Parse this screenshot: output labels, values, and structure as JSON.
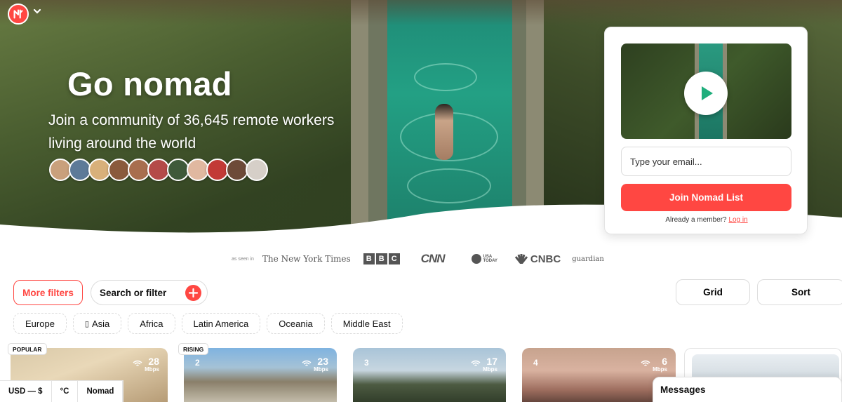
{
  "hero": {
    "title": "Go nomad",
    "subtitle": "Join a community of 36,645 remote workers living around the world"
  },
  "signup": {
    "email_placeholder": "Type your email...",
    "join_label": "Join Nomad List",
    "member_text": "Already a member?",
    "login_label": "Log in"
  },
  "press": {
    "as_seen_in": "as seen in",
    "outlets": [
      "The New York Times",
      "BBC",
      "CNN",
      "USA TODAY",
      "CNBC",
      "guardian"
    ]
  },
  "filters": {
    "more_filters": "More filters",
    "search_label": "Search or filter",
    "grid_label": "Grid",
    "sort_label": "Sort",
    "regions": [
      "Europe",
      "Asia",
      "Africa",
      "Latin America",
      "Oceania",
      "Middle East"
    ]
  },
  "cards": [
    {
      "badge": "POPULAR",
      "rank": "",
      "speed": "28",
      "unit": "Mbps"
    },
    {
      "badge": "RISING",
      "rank": "2",
      "speed": "23",
      "unit": "Mbps"
    },
    {
      "badge": "",
      "rank": "3",
      "speed": "17",
      "unit": "Mbps"
    },
    {
      "badge": "",
      "rank": "4",
      "speed": "6",
      "unit": "Mbps"
    }
  ],
  "bottombar": {
    "currency": "USD — $",
    "temperature": "°C",
    "mode": "Nomad"
  },
  "messages": {
    "label": "Messages"
  },
  "colors": {
    "accent": "#ff4742"
  }
}
